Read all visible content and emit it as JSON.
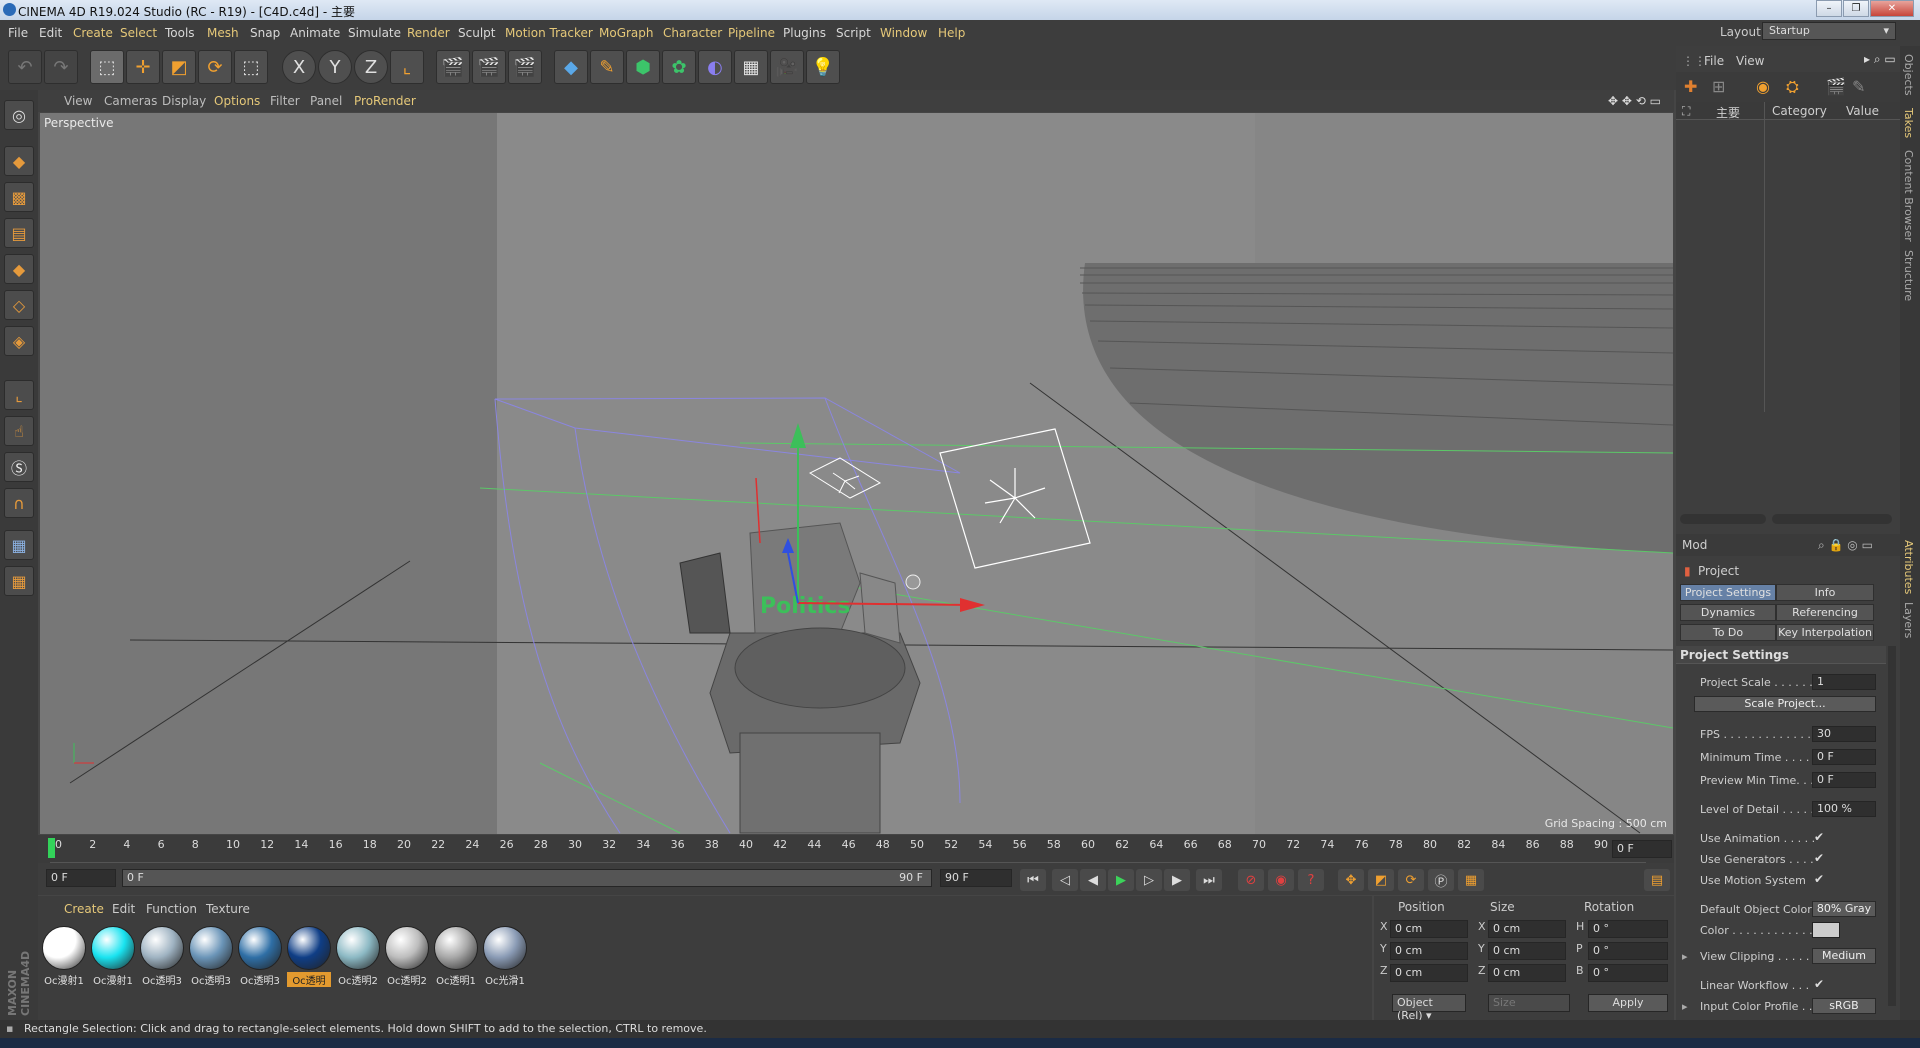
{
  "window": {
    "title": "CINEMA 4D R19.024 Studio (RC - R19) - [C4D.c4d] - 主要"
  },
  "menu": {
    "items": [
      "File",
      "Edit",
      "Create",
      "Select",
      "Tools",
      "Mesh",
      "Snap",
      "Animate",
      "Simulate",
      "Render",
      "Sculpt",
      "Motion Tracker",
      "MoGraph",
      "Character",
      "Pipeline",
      "Plugins",
      "Script",
      "Window",
      "Help"
    ]
  },
  "layout": {
    "label": "Layout:",
    "value": "Startup"
  },
  "viewport": {
    "menu": [
      "View",
      "Cameras",
      "Display",
      "Options",
      "Filter",
      "Panel",
      "ProRender"
    ],
    "label": "Perspective",
    "grid_spacing": "Grid Spacing : 500 cm",
    "text_object": "Politics"
  },
  "timeline": {
    "ticks": [
      "0",
      "2",
      "4",
      "6",
      "8",
      "10",
      "12",
      "14",
      "16",
      "18",
      "20",
      "22",
      "24",
      "26",
      "28",
      "30",
      "32",
      "34",
      "36",
      "38",
      "40",
      "42",
      "44",
      "46",
      "48",
      "50",
      "52",
      "54",
      "56",
      "58",
      "60",
      "62",
      "64",
      "66",
      "68",
      "70",
      "72",
      "74",
      "76",
      "78",
      "80",
      "82",
      "84",
      "86",
      "88",
      "90"
    ],
    "current_frame": "0 F",
    "start": "0 F",
    "range_start": "0 F",
    "range_end": "90 F",
    "end": "90 F"
  },
  "materials": {
    "menu": [
      "Create",
      "Edit",
      "Function",
      "Texture"
    ],
    "items": [
      {
        "label": "Oc漫射1",
        "color": "#ffffff"
      },
      {
        "label": "Oc漫射1",
        "color": "#19e3f0"
      },
      {
        "label": "Oc透明3",
        "color": "#9fb3c2"
      },
      {
        "label": "Oc透明3",
        "color": "#6b95b8"
      },
      {
        "label": "Oc透明3",
        "color": "#2f6fa6"
      },
      {
        "label": "Oc透明",
        "color": "#0f3e86"
      },
      {
        "label": "Oc透明2",
        "color": "#8cb9c4"
      },
      {
        "label": "Oc透明2",
        "color": "#bdbdbd"
      },
      {
        "label": "Oc透明1",
        "color": "#a8a8a8"
      },
      {
        "label": "Oc光滑1",
        "color": "#8a9bb5"
      }
    ]
  },
  "coordinates": {
    "headers": [
      "Position",
      "Size",
      "Rotation"
    ],
    "rows": [
      {
        "axis": "X",
        "pos": "0 cm",
        "saxis": "X",
        "size": "0 cm",
        "raxis": "H",
        "rot": "0 °"
      },
      {
        "axis": "Y",
        "pos": "0 cm",
        "saxis": "Y",
        "size": "0 cm",
        "raxis": "P",
        "rot": "0 °"
      },
      {
        "axis": "Z",
        "pos": "0 cm",
        "saxis": "Z",
        "size": "0 cm",
        "raxis": "B",
        "rot": "0 °"
      }
    ],
    "mode": "Object (Rel)",
    "size_mode": "Size",
    "apply": "Apply"
  },
  "objects": {
    "menu": [
      "File",
      "View"
    ],
    "columns": [
      "主要",
      "Category",
      "Value"
    ]
  },
  "attributes": {
    "mode_label": "Mod",
    "object": "Project",
    "tabs": [
      "Project Settings",
      "Info",
      "Dynamics",
      "Referencing",
      "To Do",
      "Key Interpolation"
    ],
    "section": "Project Settings",
    "rows": {
      "project_scale": {
        "label": "Project Scale . . . . . .",
        "value": "1"
      },
      "scale_project": "Scale Project...",
      "fps": {
        "label": "FPS . . . . . . . . . . . . . .",
        "value": "30"
      },
      "min_time": {
        "label": "Minimum Time . . . .",
        "value": "0 F"
      },
      "preview_min": {
        "label": "Preview Min Time. . .",
        "value": "0 F"
      },
      "lod": {
        "label": "Level of Detail . . . . .",
        "value": "100 %"
      },
      "use_animation": {
        "label": "Use Animation . . . . .",
        "value": "✔"
      },
      "use_generators": {
        "label": "Use Generators . . . .",
        "value": "✔"
      },
      "use_motion": {
        "label": "Use Motion System",
        "value": "✔"
      },
      "default_color": {
        "label": "Default Object Color",
        "value": "80% Gray"
      },
      "color": {
        "label": "Color . . . . . . . . . . . ."
      },
      "view_clipping": {
        "label": "View Clipping . . . . .",
        "value": "Medium"
      },
      "linear_workflow": {
        "label": "Linear Workflow . . .",
        "value": "✔"
      },
      "input_profile": {
        "label": "Input Color Profile . .",
        "value": "sRGB"
      }
    }
  },
  "side_tabs": [
    "Objects",
    "Takes",
    "Content Browser",
    "Structure",
    "Attributes",
    "Layers"
  ],
  "status": "Rectangle Selection: Click and drag to rectangle-select elements. Hold down SHIFT to add to the selection, CTRL to remove."
}
